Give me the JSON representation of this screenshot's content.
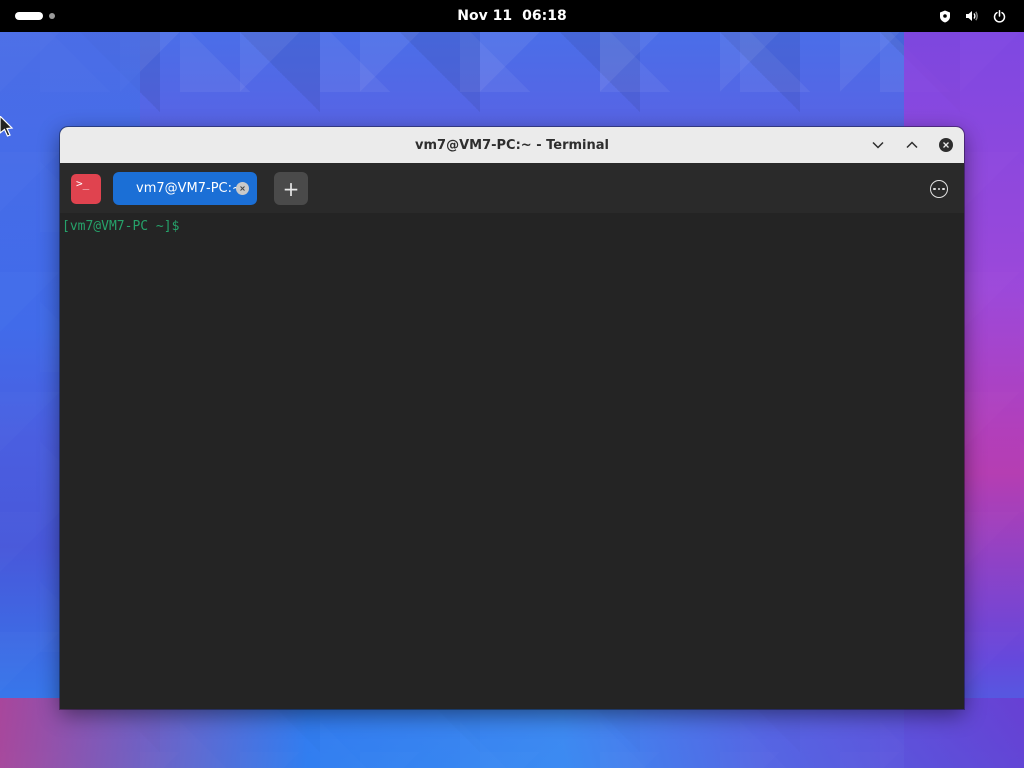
{
  "topbar": {
    "date": "Nov 11",
    "time": "06:18",
    "icons": [
      "activities-pill-icon",
      "workspace-dot-icon",
      "shield-icon",
      "volume-icon",
      "power-icon"
    ]
  },
  "window": {
    "title": "vm7@VM7-PC:~ - Terminal",
    "controls": [
      "minimize-icon",
      "maximize-icon",
      "close-icon"
    ]
  },
  "tabbar": {
    "app_icon_glyph": ">_",
    "tabs": [
      {
        "label": "vm7@VM7-PC:~",
        "active": true
      }
    ],
    "new_tab_label": "+",
    "menu_icon": "more-options-icon"
  },
  "terminal": {
    "prompt": "[vm7@VM7-PC ~]$"
  },
  "colors": {
    "accent": "#1b6fd6",
    "terminal_bg": "#242424",
    "prompt_green": "#26a26a",
    "app_icon_red": "#e0434f"
  }
}
